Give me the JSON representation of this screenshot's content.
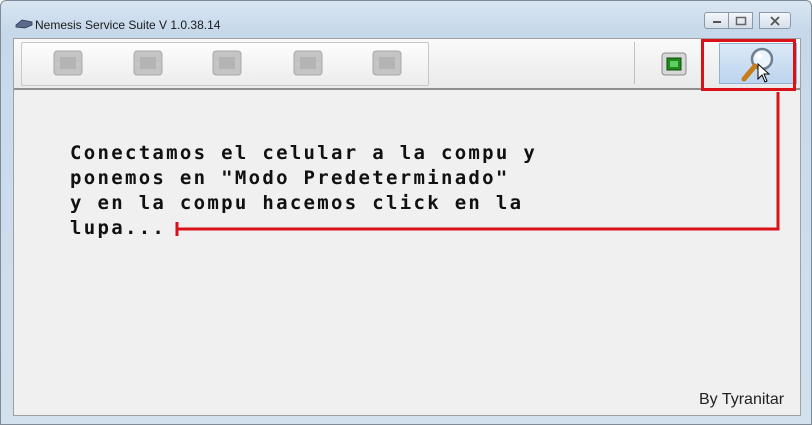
{
  "window": {
    "title": "Nemesis Service Suite V 1.0.38.14",
    "caption_buttons": [
      "minimize",
      "maximize",
      "close"
    ]
  },
  "toolbar": {
    "left_buttons": [
      "toolbar-button-1",
      "toolbar-button-2",
      "toolbar-button-3",
      "toolbar-button-4",
      "toolbar-button-5"
    ],
    "right_buttons": [
      "chip-icon",
      "magnifier-icon"
    ],
    "highlight_color": "#d81218",
    "search_button_bg": "#c8dcf2"
  },
  "content": {
    "note_lines": [
      "Conectamos el celular a la compu y",
      "ponemos en \"Modo Predeterminado\"",
      "y en la compu hacemos click en la",
      "lupa..."
    ],
    "credit": "By Tyranitar"
  }
}
